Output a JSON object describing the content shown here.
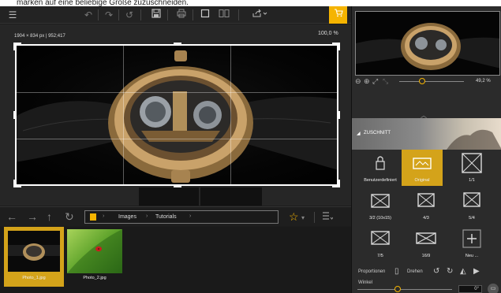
{
  "caption": "marken auf eine beliebige Größe zuzuschneiden.",
  "toolbar": {
    "icons": [
      "menu-icon",
      "undo-icon",
      "redo-icon",
      "rotate-icon",
      "save-icon",
      "print-icon",
      "single-view-icon",
      "compare-view-icon",
      "share-icon",
      "cart-icon"
    ]
  },
  "canvas": {
    "dimensions_label": "1904 × 834 px | 952;417",
    "zoom_label": "100,0 %"
  },
  "nav": {
    "path": [
      "Images",
      "Tutorials"
    ]
  },
  "filmstrip": {
    "items": [
      {
        "label": "Photo_1.jpg",
        "selected": true
      },
      {
        "label": "Photo_2.jpg",
        "selected": false
      }
    ]
  },
  "panel": {
    "zoom_percent": "49,2 %",
    "section_title": "ZUSCHNITT",
    "ratios": [
      {
        "label": "Benutzerdefiniert",
        "icon": "lock-icon",
        "selected": false
      },
      {
        "label": "Original",
        "icon": "image-ratio-icon",
        "selected": true
      },
      {
        "label": "1/1",
        "icon": "ratio-1-1-icon",
        "selected": false
      },
      {
        "label": "3/2 (10x15)",
        "icon": "ratio-3-2-icon",
        "selected": false
      },
      {
        "label": "4/3",
        "icon": "ratio-4-3-icon",
        "selected": false
      },
      {
        "label": "5/4",
        "icon": "ratio-5-4-icon",
        "selected": false
      },
      {
        "label": "7/5",
        "icon": "ratio-7-5-icon",
        "selected": false
      },
      {
        "label": "16/9",
        "icon": "ratio-16-9-icon",
        "selected": false
      },
      {
        "label": "Neu ...",
        "icon": "plus-icon",
        "selected": false
      }
    ],
    "proportions_label": "Proportionen",
    "rotate_label": "Drehen",
    "angle_label": "Winkel",
    "angle_value": "0°",
    "accent": "#d4a31a"
  }
}
